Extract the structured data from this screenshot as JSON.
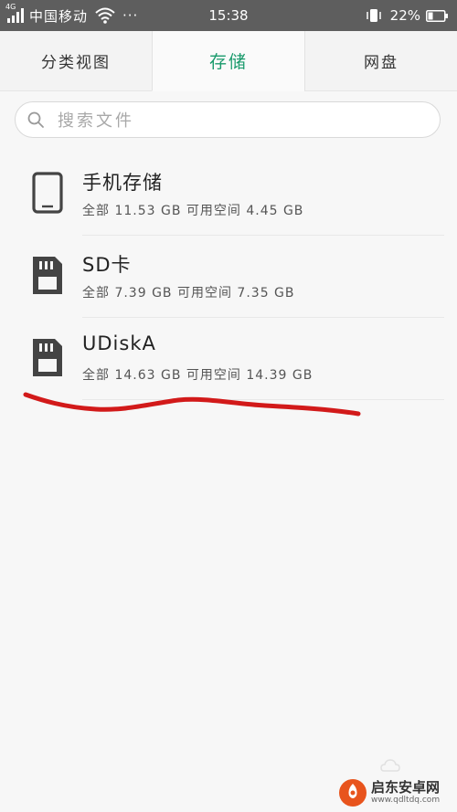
{
  "status_bar": {
    "network_type": "4G",
    "carrier": "中国移动",
    "more": "···",
    "time": "15:38",
    "battery_percent": "22%",
    "icons": [
      "signal-icon",
      "wifi-icon",
      "vibrate-icon",
      "battery-icon"
    ]
  },
  "tabs": [
    {
      "label": "分类视图",
      "active": false
    },
    {
      "label": "存储",
      "active": true
    },
    {
      "label": "网盘",
      "active": false
    }
  ],
  "search": {
    "placeholder": "搜索文件",
    "icon": "search-icon"
  },
  "storage_items": [
    {
      "name": "手机存储",
      "detail": "全部 11.53 GB 可用空间 4.45 GB",
      "icon": "phone-icon"
    },
    {
      "name": "SD卡",
      "detail": "全部 7.39 GB 可用空间 7.35 GB",
      "icon": "sd-card-icon"
    },
    {
      "name": "UDiskA",
      "detail": "全部 14.63 GB 可用空间 14.39 GB",
      "icon": "sd-card-icon"
    }
  ],
  "watermark": {
    "name": "启东安卓网",
    "url": "www.qdltdq.com"
  },
  "colors": {
    "accent": "#1a9a6c",
    "status_bar": "#5e5e5e",
    "background": "#f7f7f7",
    "annotation": "#d21a1a",
    "icon": "#444444"
  }
}
